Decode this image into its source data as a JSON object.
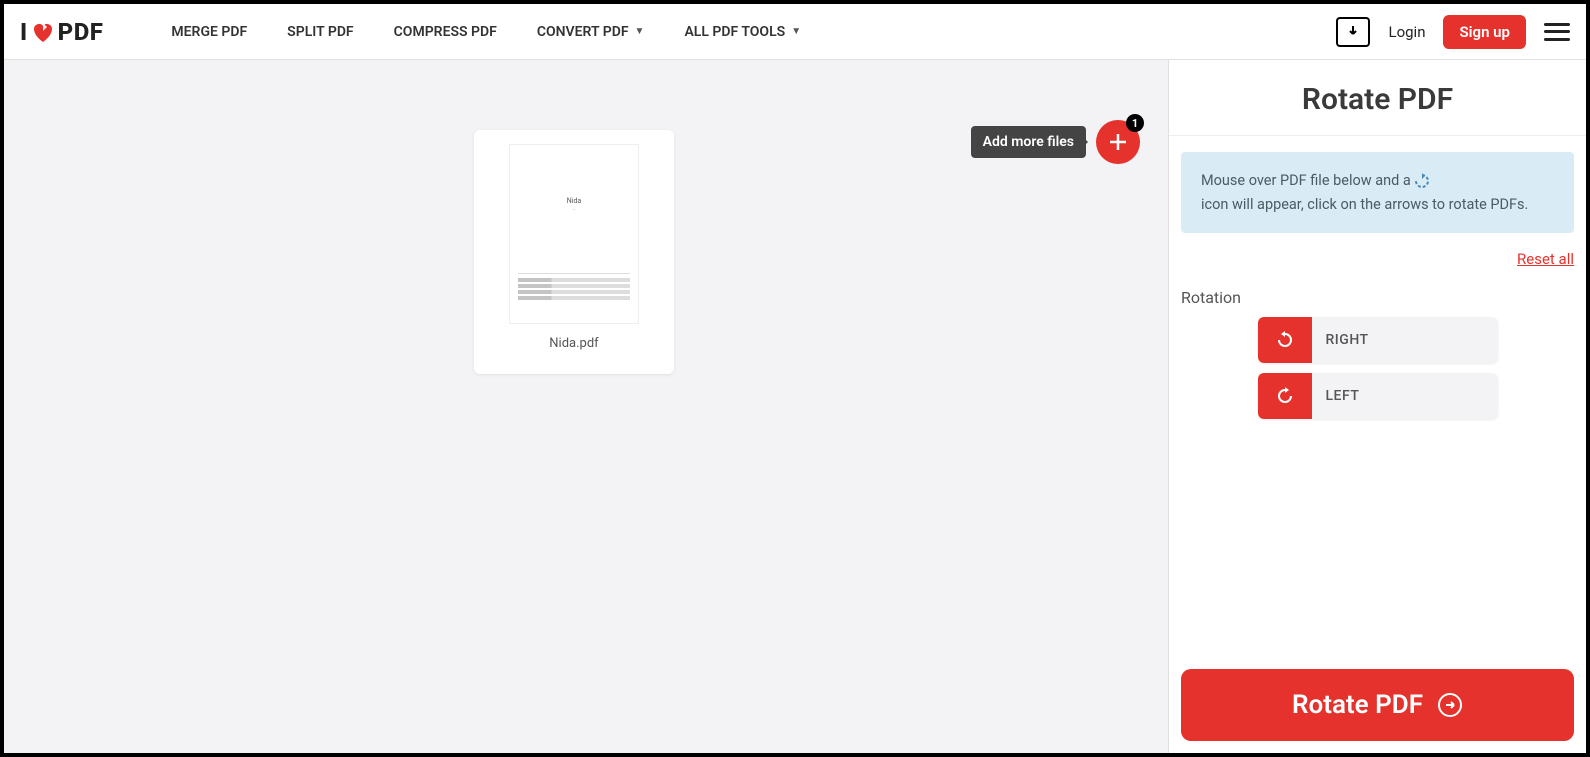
{
  "brand": {
    "prefix": "I",
    "suffix": "PDF"
  },
  "nav": {
    "merge": "MERGE PDF",
    "split": "SPLIT PDF",
    "compress": "COMPRESS PDF",
    "convert": "CONVERT PDF",
    "all": "ALL PDF TOOLS"
  },
  "auth": {
    "login": "Login",
    "signup": "Sign up"
  },
  "file": {
    "name": "Nida.pdf",
    "preview_title": "Nida",
    "preview_sub": "—"
  },
  "add": {
    "tooltip": "Add more files",
    "badge": "1"
  },
  "sidebar": {
    "title": "Rotate PDF",
    "info_pre": "Mouse over PDF file below and a",
    "info_post": "icon will appear, click on the arrows to rotate PDFs.",
    "reset": "Reset all",
    "rotation_label": "Rotation",
    "right": "RIGHT",
    "left": "LEFT",
    "action": "Rotate PDF"
  }
}
